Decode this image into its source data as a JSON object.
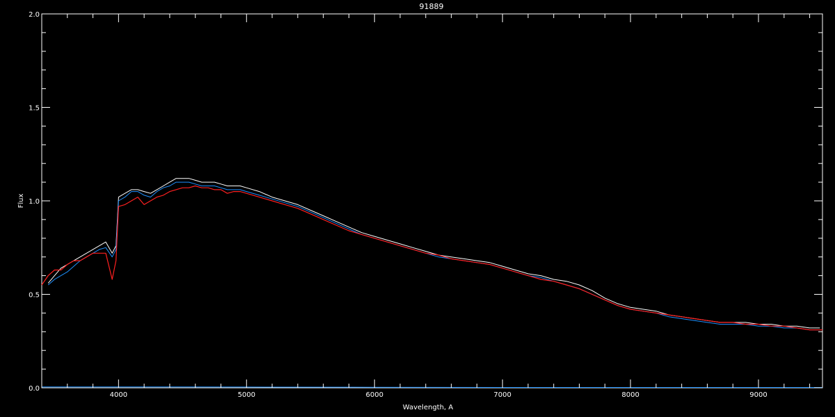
{
  "chart_data": {
    "type": "line",
    "title": "91889",
    "xlabel": "Wavelength, A",
    "ylabel": "Flux",
    "xlim": [
      3400,
      9500
    ],
    "ylim": [
      0.0,
      2.0
    ],
    "x_ticks": [
      4000,
      5000,
      6000,
      7000,
      8000,
      9000
    ],
    "x_tick_labels": [
      "4000",
      "5000",
      "6000",
      "7000",
      "8000",
      "9000"
    ],
    "y_ticks": [
      0.0,
      0.5,
      1.0,
      1.5,
      2.0
    ],
    "y_tick_labels": [
      "0.0",
      "0.5",
      "1.0",
      "1.5",
      "2.0"
    ],
    "grid": false,
    "background_color": "#000000",
    "axis_color": "#ffffff",
    "series": [
      {
        "color": "#ffffff",
        "x": [
          3450,
          3500,
          3550,
          3600,
          3650,
          3700,
          3750,
          3800,
          3850,
          3900,
          3950,
          3980,
          4000,
          4050,
          4100,
          4150,
          4200,
          4250,
          4300,
          4350,
          4400,
          4450,
          4500,
          4550,
          4600,
          4650,
          4700,
          4750,
          4800,
          4850,
          4900,
          4950,
          5000,
          5100,
          5200,
          5300,
          5400,
          5500,
          5600,
          5700,
          5800,
          5900,
          6000,
          6100,
          6200,
          6300,
          6400,
          6500,
          6600,
          6700,
          6800,
          6900,
          7000,
          7100,
          7200,
          7300,
          7400,
          7500,
          7600,
          7700,
          7800,
          7900,
          8000,
          8100,
          8200,
          8300,
          8400,
          8500,
          8600,
          8700,
          8800,
          8900,
          9000,
          9100,
          9200,
          9300,
          9400,
          9480
        ],
        "y": [
          0.56,
          0.6,
          0.64,
          0.66,
          0.68,
          0.7,
          0.72,
          0.74,
          0.76,
          0.78,
          0.72,
          0.76,
          1.02,
          1.04,
          1.06,
          1.06,
          1.05,
          1.04,
          1.06,
          1.08,
          1.1,
          1.12,
          1.12,
          1.12,
          1.11,
          1.1,
          1.1,
          1.1,
          1.09,
          1.08,
          1.08,
          1.08,
          1.07,
          1.05,
          1.02,
          1.0,
          0.98,
          0.95,
          0.92,
          0.89,
          0.86,
          0.83,
          0.81,
          0.79,
          0.77,
          0.75,
          0.73,
          0.71,
          0.7,
          0.69,
          0.68,
          0.67,
          0.65,
          0.63,
          0.61,
          0.6,
          0.58,
          0.57,
          0.55,
          0.52,
          0.48,
          0.45,
          0.43,
          0.42,
          0.41,
          0.39,
          0.38,
          0.37,
          0.36,
          0.35,
          0.35,
          0.35,
          0.34,
          0.34,
          0.33,
          0.33,
          0.32,
          0.32
        ]
      },
      {
        "color": "#1e90ff",
        "x": [
          3450,
          3500,
          3550,
          3600,
          3650,
          3700,
          3750,
          3800,
          3850,
          3900,
          3950,
          3980,
          4000,
          4050,
          4100,
          4150,
          4200,
          4250,
          4300,
          4350,
          4400,
          4450,
          4500,
          4550,
          4600,
          4650,
          4700,
          4750,
          4800,
          4850,
          4900,
          4950,
          5000,
          5100,
          5200,
          5300,
          5400,
          5500,
          5600,
          5700,
          5800,
          5900,
          6000,
          6100,
          6200,
          6300,
          6400,
          6500,
          6600,
          6700,
          6800,
          6900,
          7000,
          7100,
          7200,
          7300,
          7400,
          7500,
          7600,
          7700,
          7800,
          7900,
          8000,
          8100,
          8200,
          8300,
          8400,
          8500,
          8600,
          8700,
          8800,
          8900,
          9000,
          9100,
          9200,
          9300,
          9400,
          9480
        ],
        "y": [
          0.55,
          0.58,
          0.6,
          0.62,
          0.65,
          0.68,
          0.7,
          0.72,
          0.74,
          0.75,
          0.7,
          0.74,
          1.0,
          1.02,
          1.05,
          1.05,
          1.03,
          1.02,
          1.05,
          1.07,
          1.08,
          1.1,
          1.1,
          1.1,
          1.09,
          1.08,
          1.08,
          1.08,
          1.07,
          1.06,
          1.06,
          1.06,
          1.05,
          1.03,
          1.01,
          0.99,
          0.97,
          0.94,
          0.91,
          0.88,
          0.85,
          0.82,
          0.8,
          0.78,
          0.76,
          0.74,
          0.72,
          0.7,
          0.69,
          0.68,
          0.67,
          0.66,
          0.64,
          0.62,
          0.6,
          0.59,
          0.57,
          0.55,
          0.53,
          0.5,
          0.47,
          0.44,
          0.42,
          0.41,
          0.4,
          0.38,
          0.37,
          0.36,
          0.35,
          0.34,
          0.34,
          0.34,
          0.33,
          0.33,
          0.32,
          0.32,
          0.31,
          0.31
        ]
      },
      {
        "color": "#ff2020",
        "x": [
          3400,
          3450,
          3500,
          3550,
          3600,
          3650,
          3700,
          3750,
          3800,
          3850,
          3900,
          3950,
          3980,
          4000,
          4050,
          4100,
          4150,
          4200,
          4250,
          4300,
          4350,
          4400,
          4450,
          4500,
          4550,
          4600,
          4650,
          4700,
          4750,
          4800,
          4850,
          4900,
          4950,
          5000,
          5100,
          5200,
          5300,
          5400,
          5500,
          5600,
          5700,
          5800,
          5900,
          6000,
          6100,
          6200,
          6300,
          6400,
          6500,
          6600,
          6700,
          6800,
          6900,
          7000,
          7100,
          7200,
          7300,
          7400,
          7500,
          7600,
          7700,
          7800,
          7900,
          8000,
          8100,
          8200,
          8300,
          8400,
          8500,
          8600,
          8700,
          8800,
          8900,
          9000,
          9100,
          9200,
          9300,
          9400,
          9500
        ],
        "y": [
          0.55,
          0.6,
          0.63,
          0.63,
          0.66,
          0.68,
          0.68,
          0.7,
          0.72,
          0.72,
          0.72,
          0.58,
          0.68,
          0.97,
          0.98,
          1.0,
          1.02,
          0.98,
          1.0,
          1.02,
          1.03,
          1.05,
          1.06,
          1.07,
          1.07,
          1.08,
          1.07,
          1.07,
          1.06,
          1.06,
          1.04,
          1.05,
          1.05,
          1.04,
          1.02,
          1.0,
          0.98,
          0.96,
          0.93,
          0.9,
          0.87,
          0.84,
          0.82,
          0.8,
          0.78,
          0.76,
          0.74,
          0.72,
          0.71,
          0.69,
          0.68,
          0.67,
          0.66,
          0.64,
          0.62,
          0.6,
          0.58,
          0.57,
          0.55,
          0.53,
          0.5,
          0.47,
          0.44,
          0.42,
          0.41,
          0.4,
          0.39,
          0.38,
          0.37,
          0.36,
          0.35,
          0.35,
          0.34,
          0.34,
          0.33,
          0.33,
          0.32,
          0.31,
          0.31
        ]
      },
      {
        "color": "#1e90ff",
        "x": [
          3400,
          4000,
          5000,
          6000,
          7000,
          8000,
          9000,
          9500
        ],
        "y": [
          0.005,
          0.005,
          0.004,
          0.003,
          0.002,
          0.002,
          0.002,
          0.002
        ]
      }
    ]
  }
}
